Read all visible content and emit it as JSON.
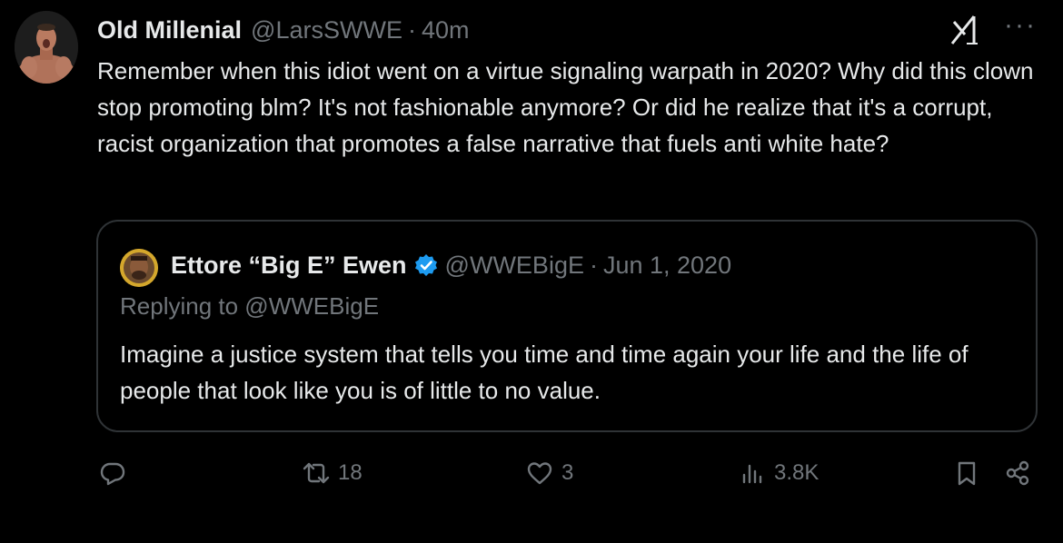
{
  "tweet": {
    "display_name": "Old Millenial",
    "handle": "@LarsSWWE",
    "separator": "·",
    "time": "40m",
    "text": "Remember when this idiot went on a virtue signaling warpath in 2020? Why did this clown stop promoting blm? It's not fashionable anymore? Or did he realize that it's a corrupt, racist organization that promotes a false narrative that fuels anti white hate?",
    "more_label": "···"
  },
  "quoted": {
    "display_name": "Ettore “Big E” Ewen",
    "handle": "@WWEBigE",
    "separator": "·",
    "date": "Jun 1, 2020",
    "replying_to": "Replying to @WWEBigE",
    "text": "Imagine a justice system that tells you time and time again your life and the life of people that look like you is of little to no value."
  },
  "actions": {
    "reply_icon": "reply-icon",
    "retweet_count": "18",
    "like_count": "3",
    "views_count": "3.8K",
    "bookmark_icon": "bookmark-icon",
    "share_icon": "share-icon"
  },
  "colors": {
    "background": "#000000",
    "text": "#e7e9ea",
    "muted": "#71767b",
    "verified": "#1d9bf0",
    "border": "#2f3336"
  }
}
